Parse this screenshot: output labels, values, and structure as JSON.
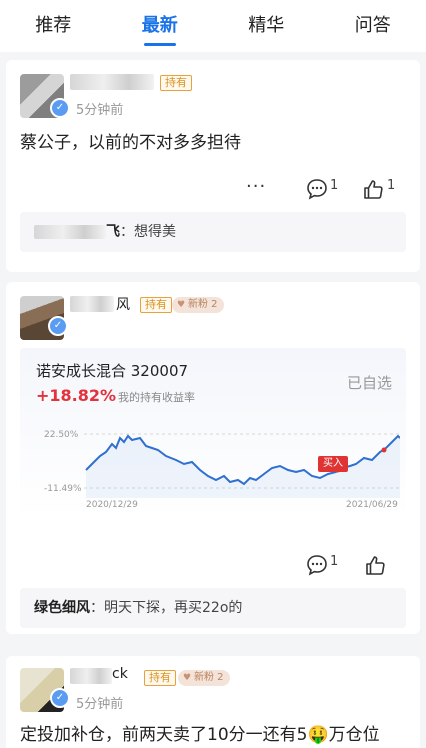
{
  "tabs": [
    {
      "label": "推荐",
      "active": false
    },
    {
      "label": "最新",
      "active": true
    },
    {
      "label": "精华",
      "active": false
    },
    {
      "label": "问答",
      "active": false
    }
  ],
  "posts": [
    {
      "tag": "持有",
      "time": "5分钟前",
      "content": "蔡公子，以前的不对多多担待",
      "comments": "1",
      "likes": "1",
      "reply_user_tail": "飞",
      "reply_text": "：想得美"
    },
    {
      "name_tail": "风",
      "tag": "持有",
      "fans": "新粉 2",
      "fund": {
        "name": "诺安成长混合 320007",
        "return": "+18.82%",
        "return_label": "我的持有收益率",
        "selected": "已自选",
        "y_top": "22.50%",
        "y_bottom": "-11.49%",
        "x_start": "2020/12/29",
        "x_end": "2021/06/29",
        "buy_label": "买入"
      },
      "comments": "1",
      "reply_user": "绿色细风",
      "reply_text": "：明天下探，再买22o的"
    },
    {
      "name_tail": "ck",
      "tag": "持有",
      "fans": "新粉 2",
      "time": "5分钟前",
      "content": "定投加补仓，前两天卖了10分一还有5🤑万仓位"
    }
  ],
  "colors": {
    "accent": "#1a73e8",
    "up": "#e2323c",
    "line": "#2f6fd0"
  }
}
